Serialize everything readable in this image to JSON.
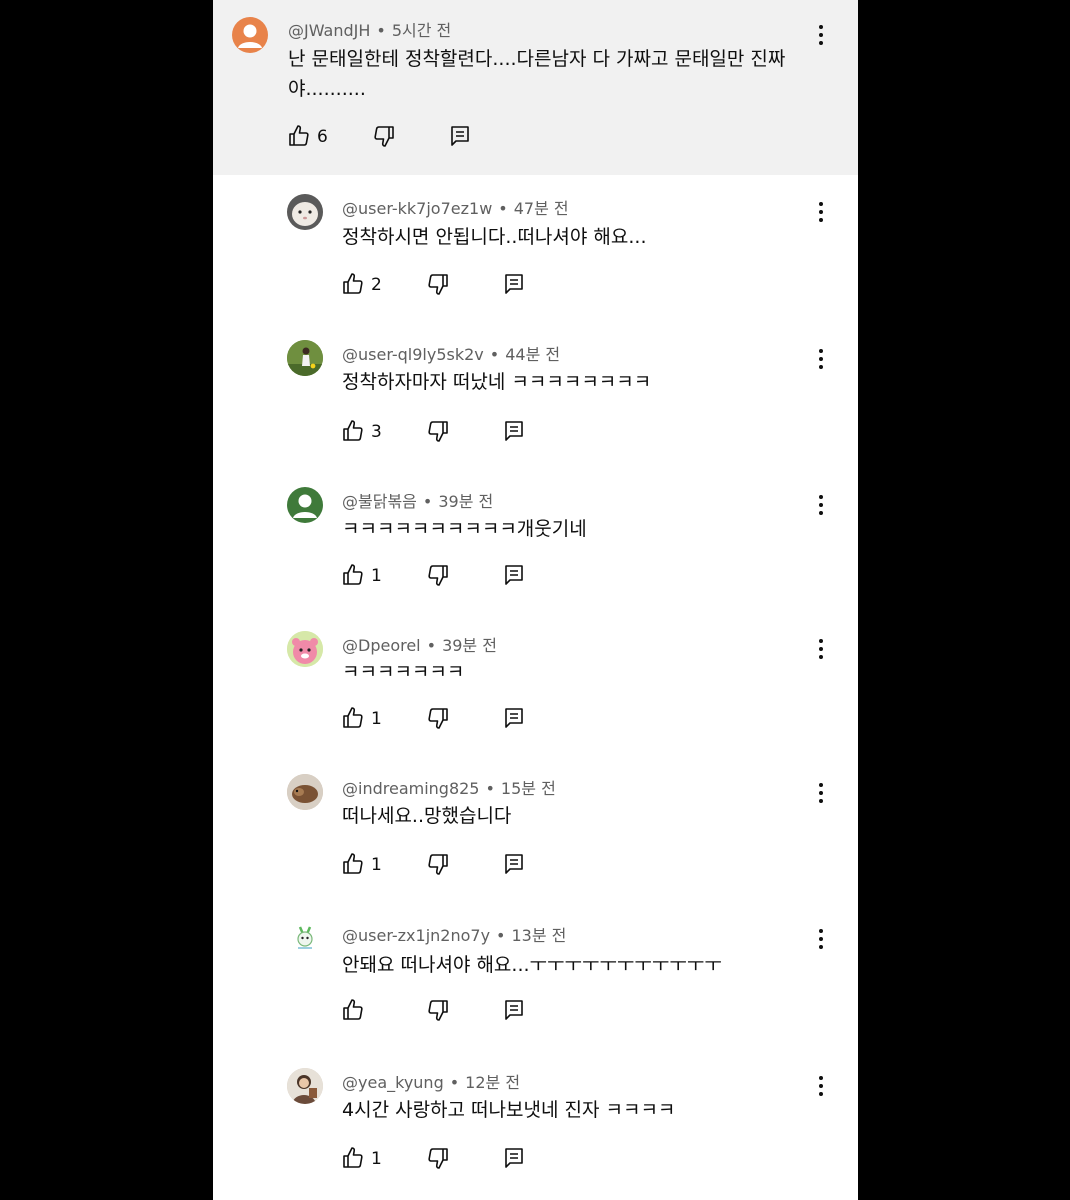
{
  "main_comment": {
    "handle": "@JWandJH",
    "time": "5시간 전",
    "text_line1": "난 문태일한테 정착할련다....다른남자 다 가짜고 문태일만 진짜",
    "text_line2": "야..........",
    "likes": "6"
  },
  "replies": [
    {
      "handle": "@user-kk7jo7ez1w",
      "time": "47분 전",
      "text": "정착하시면 안됩니다..떠나셔야 해요...",
      "likes": "2"
    },
    {
      "handle": "@user-ql9ly5sk2v",
      "time": "44분 전",
      "text": "정착하자마자 떠났네 ㅋㅋㅋㅋㅋㅋㅋㅋ",
      "likes": "3"
    },
    {
      "handle": "@불닭볶음",
      "time": "39분 전",
      "text": "ㅋㅋㅋㅋㅋㅋㅋㅋㅋㅋ개웃기네",
      "likes": "1"
    },
    {
      "handle": "@Dpeorel",
      "time": "39분 전",
      "text": "ㅋㅋㅋㅋㅋㅋㅋ",
      "likes": "1"
    },
    {
      "handle": "@indreaming825",
      "time": "15분 전",
      "text": "떠나세요..망했습니다",
      "likes": "1"
    },
    {
      "handle": "@user-zx1jn2no7y",
      "time": "13분 전",
      "text": "안돼요 떠나셔야 해요...ㅜㅜㅜㅜㅜㅜㅜㅜㅜㅜㅜ",
      "likes": ""
    },
    {
      "handle": "@yea_kyung",
      "time": "12분 전",
      "text": "4시간 사랑하고 떠나보냇네 진자 ㅋㅋㅋㅋ",
      "likes": "1"
    }
  ],
  "colors": {
    "page_bg": "#000000",
    "panel_bg": "#ffffff",
    "highlight_bg": "#f1f1f1",
    "meta_text": "#606060",
    "body_text": "#0f0f0f"
  }
}
